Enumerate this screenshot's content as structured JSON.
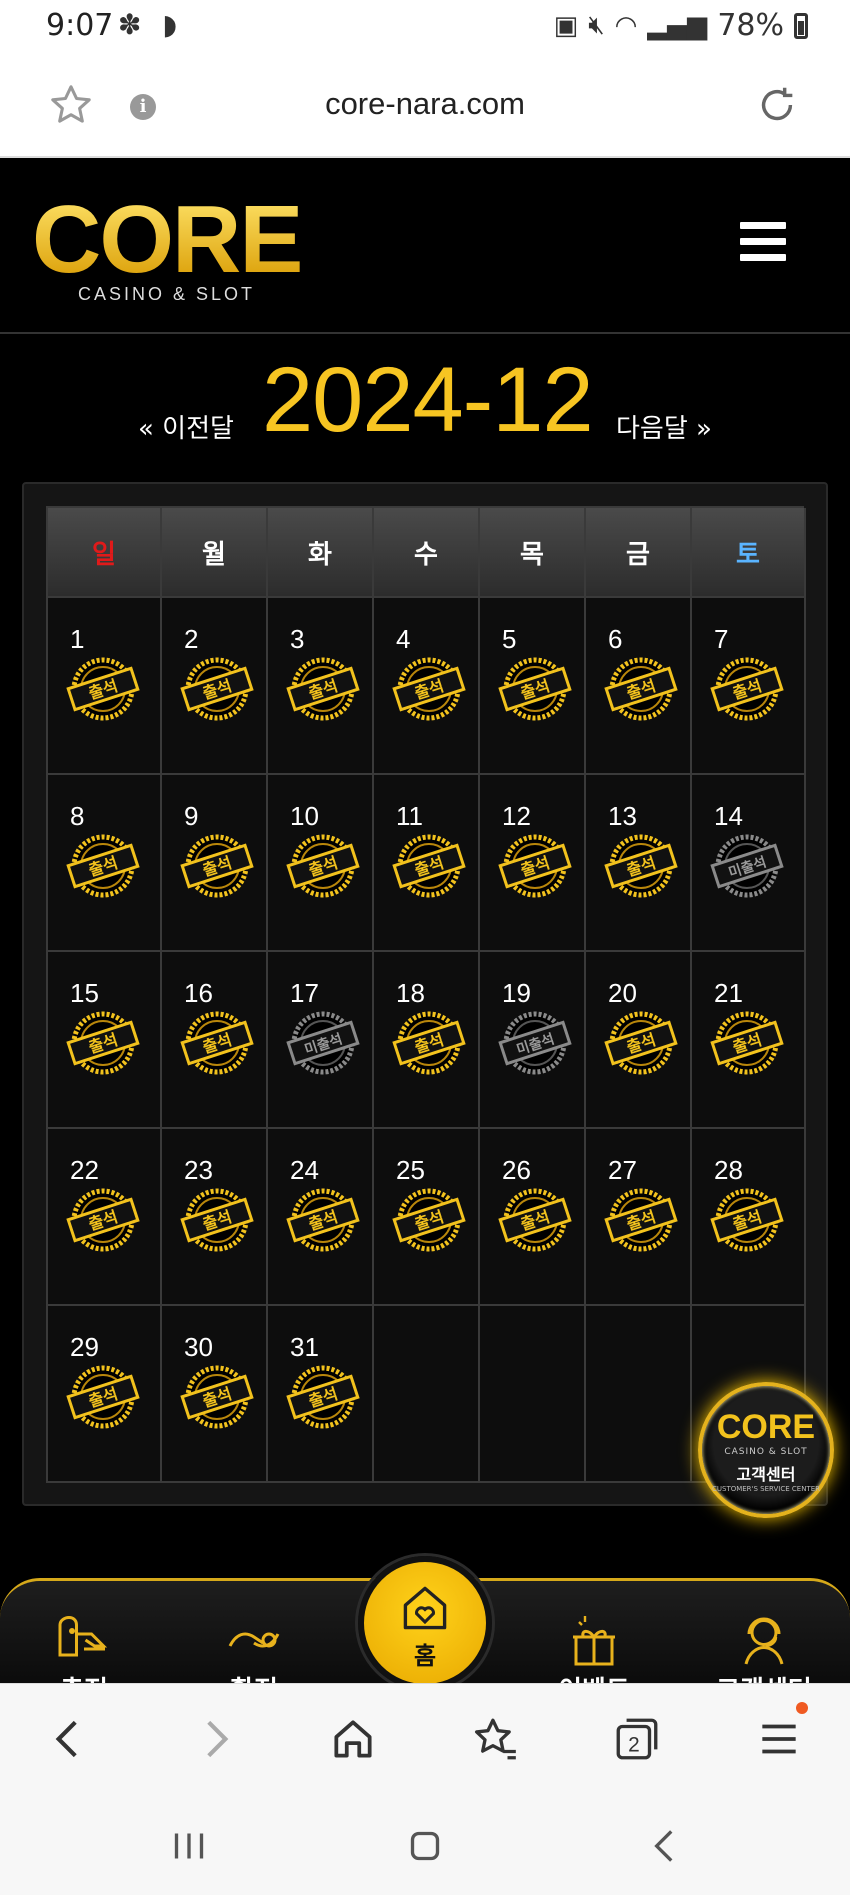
{
  "status_bar": {
    "time": "9:07",
    "left_icons": "✽ ◗",
    "battery": "78%"
  },
  "browser": {
    "url": "core-nara.com"
  },
  "site": {
    "logo_word": "CORE",
    "logo_sub": "CASINO & SLOT",
    "prev_label": "« 이전달",
    "next_label": "다음달 »",
    "month_title": "2024-12"
  },
  "calendar": {
    "weekdays": [
      "일",
      "월",
      "화",
      "수",
      "목",
      "금",
      "토"
    ],
    "weekday_colors": [
      "#e01a1a",
      "#ffffff",
      "#ffffff",
      "#ffffff",
      "#ffffff",
      "#ffffff",
      "#5ab4ff"
    ],
    "present_label": "출석",
    "absent_label": "미출석",
    "days": [
      {
        "num": "1",
        "status": "present"
      },
      {
        "num": "2",
        "status": "present"
      },
      {
        "num": "3",
        "status": "present"
      },
      {
        "num": "4",
        "status": "present"
      },
      {
        "num": "5",
        "status": "present"
      },
      {
        "num": "6",
        "status": "present"
      },
      {
        "num": "7",
        "status": "present"
      },
      {
        "num": "8",
        "status": "present"
      },
      {
        "num": "9",
        "status": "present"
      },
      {
        "num": "10",
        "status": "present"
      },
      {
        "num": "11",
        "status": "present"
      },
      {
        "num": "12",
        "status": "present"
      },
      {
        "num": "13",
        "status": "present"
      },
      {
        "num": "14",
        "status": "absent"
      },
      {
        "num": "15",
        "status": "present"
      },
      {
        "num": "16",
        "status": "present"
      },
      {
        "num": "17",
        "status": "absent"
      },
      {
        "num": "18",
        "status": "present"
      },
      {
        "num": "19",
        "status": "absent"
      },
      {
        "num": "20",
        "status": "present"
      },
      {
        "num": "21",
        "status": "present"
      },
      {
        "num": "22",
        "status": "present"
      },
      {
        "num": "23",
        "status": "present"
      },
      {
        "num": "24",
        "status": "present"
      },
      {
        "num": "25",
        "status": "present"
      },
      {
        "num": "26",
        "status": "present"
      },
      {
        "num": "27",
        "status": "present"
      },
      {
        "num": "28",
        "status": "present"
      },
      {
        "num": "29",
        "status": "present"
      },
      {
        "num": "30",
        "status": "present"
      },
      {
        "num": "31",
        "status": "present"
      },
      {
        "num": "",
        "status": "empty"
      },
      {
        "num": "",
        "status": "empty"
      },
      {
        "num": "",
        "status": "empty"
      },
      {
        "num": "",
        "status": "empty"
      }
    ]
  },
  "support_float": {
    "word": "CORE",
    "sub": "CASINO & SLOT",
    "label": "고객센터",
    "en": "CUSTOMER'S SERVICE CENTER"
  },
  "bottom_nav": {
    "deposit": "충전",
    "withdraw": "환전",
    "home": "홈",
    "event": "이벤트",
    "support": "고객센터"
  },
  "browser_toolbar": {
    "tab_count": "2"
  },
  "colors": {
    "accent": "#f7c522",
    "background": "#000000"
  }
}
